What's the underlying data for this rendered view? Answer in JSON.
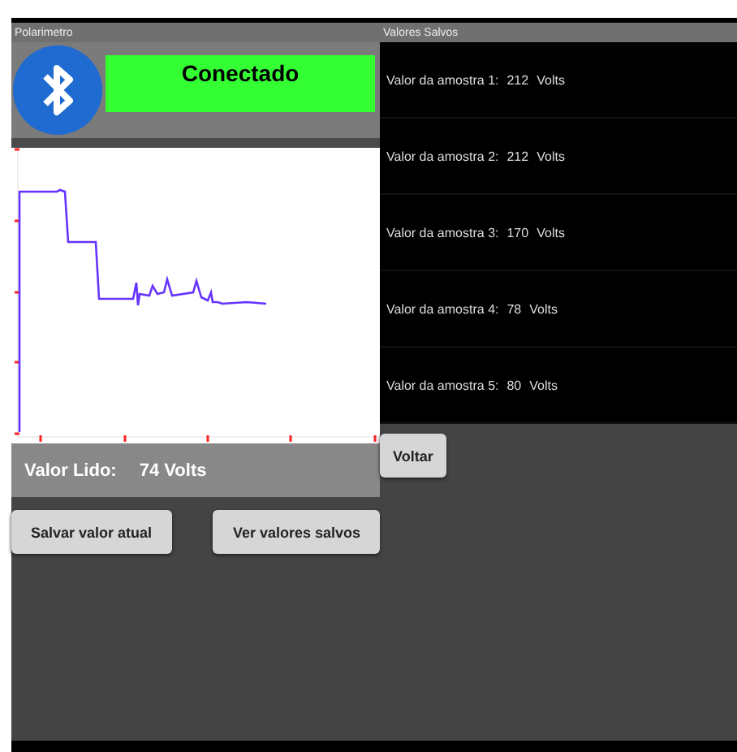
{
  "left_panel": {
    "title": "Polarimetro",
    "connection": {
      "status": "Conectado",
      "connected": true
    },
    "reading": {
      "label": "Valor Lido:",
      "value": "74",
      "unit": "Volts"
    },
    "buttons": [
      "Salvar valor atual",
      "Ver valores salvos"
    ]
  },
  "right_panel": {
    "title": "Valores Salvos",
    "samples": [
      {
        "label": "Valor da amostra",
        "index": "1:",
        "value": "212",
        "unit": "Volts"
      },
      {
        "label": "Valor da amostra",
        "index": "2:",
        "value": "212",
        "unit": "Volts"
      },
      {
        "label": "Valor da amostra",
        "index": "3:",
        "value": "170",
        "unit": "Volts"
      },
      {
        "label": "Valor da amostra",
        "index": "4:",
        "value": "78",
        "unit": "Volts"
      },
      {
        "label": "Valor da amostra",
        "index": "5:",
        "value": "80",
        "unit": "Volts"
      }
    ],
    "back_button": "Voltar"
  }
}
